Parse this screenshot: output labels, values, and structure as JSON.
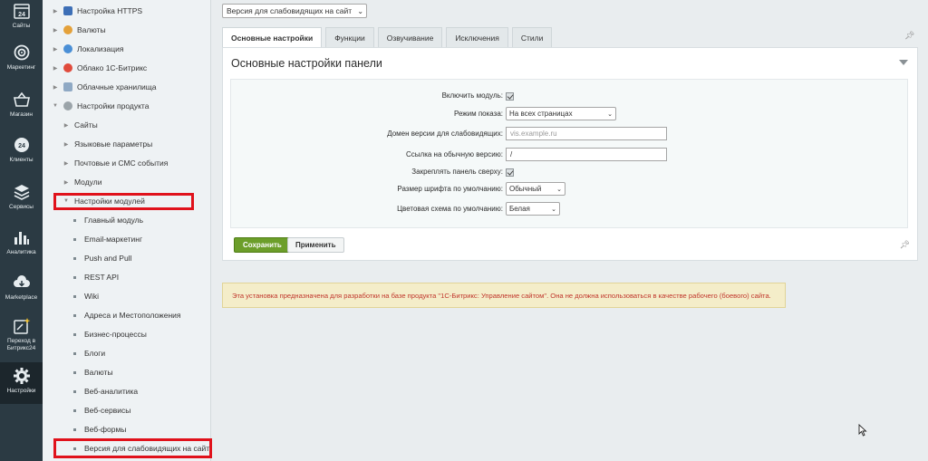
{
  "rail": {
    "items": [
      {
        "label": "Сайты",
        "icon": "calendar-24-icon"
      },
      {
        "label": "Маркетинг",
        "icon": "target-icon"
      },
      {
        "label": "Магазин",
        "icon": "basket-icon"
      },
      {
        "label": "Клиенты",
        "icon": "clients-24-icon"
      },
      {
        "label": "Сервисы",
        "icon": "layers-icon"
      },
      {
        "label": "Аналитика",
        "icon": "bar-chart-icon"
      },
      {
        "label": "Marketplace",
        "icon": "cloud-download-icon"
      },
      {
        "label": "Переход в Битрикс24",
        "icon": "bitrix24-transition-icon"
      },
      {
        "label": "Настройки",
        "icon": "gear-icon"
      }
    ]
  },
  "tree": {
    "items": [
      {
        "label": "Настройка HTTPS"
      },
      {
        "label": "Валюты"
      },
      {
        "label": "Локализация"
      },
      {
        "label": "Облако 1С-Битрикс"
      },
      {
        "label": "Облачные хранилища"
      },
      {
        "label": "Настройки продукта"
      },
      {
        "label": "Сайты"
      },
      {
        "label": "Языковые параметры"
      },
      {
        "label": "Почтовые и СМС события"
      },
      {
        "label": "Модули"
      },
      {
        "label": "Настройки модулей"
      },
      {
        "label": "Главный модуль"
      },
      {
        "label": "Email-маркетинг"
      },
      {
        "label": "Push and Pull"
      },
      {
        "label": "REST API"
      },
      {
        "label": "Wiki"
      },
      {
        "label": "Адреса и Местоположения"
      },
      {
        "label": "Бизнес-процессы"
      },
      {
        "label": "Блоги"
      },
      {
        "label": "Валюты"
      },
      {
        "label": "Веб-аналитика"
      },
      {
        "label": "Веб-сервисы"
      },
      {
        "label": "Веб-формы"
      },
      {
        "label": "Версия для слабовидящих на сайт"
      }
    ]
  },
  "main": {
    "site_select": "Версия для слабовидящих на сайт",
    "tabs": [
      {
        "label": "Основные настройки"
      },
      {
        "label": "Функции"
      },
      {
        "label": "Озвучивание"
      },
      {
        "label": "Исключения"
      },
      {
        "label": "Стили"
      }
    ],
    "panel_title": "Основные настройки панели",
    "fields": {
      "enable_module": {
        "label": "Включить модуль:"
      },
      "display_mode": {
        "label": "Режим показа:",
        "value": "На всех страницах"
      },
      "domain": {
        "label": "Домен версии для слабовидящих:",
        "placeholder": "vis.example.ru"
      },
      "normal_link": {
        "label": "Ссылка на обычную версию:",
        "value": "/"
      },
      "pin_top": {
        "label": "Закреплять панель сверху:"
      },
      "font_size": {
        "label": "Размер шрифта по умолчанию:",
        "value": "Обычный"
      },
      "color_scheme": {
        "label": "Цветовая схема по умолчанию:",
        "value": "Белая"
      }
    },
    "save_label": "Сохранить",
    "apply_label": "Применить",
    "warning": "Эта установка предназначена для разработки на базе продукта \"1С-Битрикс: Управление сайтом\". Она не должна использоваться в качестве рабочего (боевого) сайта."
  },
  "colors": {
    "rail_bg": "#2b3a43",
    "save_green": "#6c9e2a",
    "highlight_red": "#e0121b",
    "warning_text": "#c0362c",
    "warning_bg": "#f4edc9"
  }
}
